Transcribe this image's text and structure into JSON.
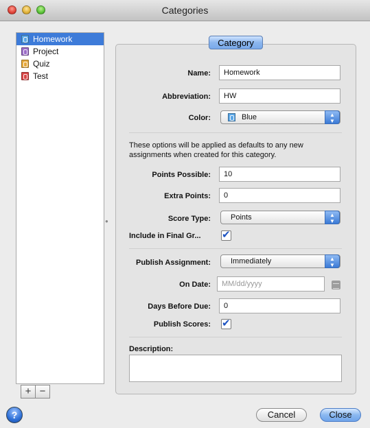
{
  "window": {
    "title": "Categories"
  },
  "sidebar": {
    "items": [
      {
        "label": "Homework",
        "color": "#5aa6e6",
        "selected": true
      },
      {
        "label": "Project",
        "color": "#9b6cc7",
        "selected": false
      },
      {
        "label": "Quiz",
        "color": "#e7a93b",
        "selected": false
      },
      {
        "label": "Test",
        "color": "#d94545",
        "selected": false
      }
    ],
    "add_label": "+",
    "remove_label": "−"
  },
  "tab": {
    "label": "Category"
  },
  "form": {
    "name": {
      "label": "Name:",
      "value": "Homework"
    },
    "abbreviation": {
      "label": "Abbreviation:",
      "value": "HW"
    },
    "color": {
      "label": "Color:",
      "value": "Blue",
      "swatch": "#5aa6e6"
    },
    "note": "These options will be applied as defaults to any new assignments when created for this category.",
    "points_possible": {
      "label": "Points Possible:",
      "value": "10"
    },
    "extra_points": {
      "label": "Extra Points:",
      "value": "0"
    },
    "score_type": {
      "label": "Score Type:",
      "value": "Points"
    },
    "include_final": {
      "label": "Include in Final Gr...",
      "checked": true
    },
    "publish_assignment": {
      "label": "Publish Assignment:",
      "value": "Immediately"
    },
    "on_date": {
      "label": "On Date:",
      "placeholder": "MM/dd/yyyy"
    },
    "days_before_due": {
      "label": "Days Before Due:",
      "value": "0"
    },
    "publish_scores": {
      "label": "Publish Scores:",
      "checked": true
    },
    "description": {
      "label": "Description:",
      "value": ""
    }
  },
  "footer": {
    "help_label": "?",
    "cancel_label": "Cancel",
    "close_label": "Close"
  }
}
